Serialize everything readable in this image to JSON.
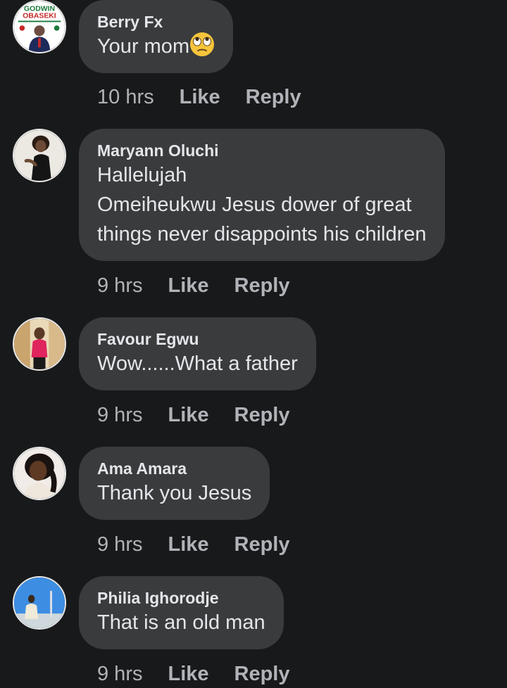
{
  "comments": [
    {
      "author": "Berry Fx",
      "lines": [
        "Your mom"
      ],
      "emoji": "eye-roll-emoji",
      "time": "10 hrs",
      "like_label": "Like",
      "reply_label": "Reply",
      "avatar": {
        "icon": "campaign-poster-avatar",
        "logo_text_1": "GODWIN",
        "logo_text_2": "OBASEKI"
      }
    },
    {
      "author": "Maryann Oluchi",
      "lines": [
        "Hallelujah",
        "Omeiheukwu Jesus dower of great",
        "things never disappoints his children"
      ],
      "time": "9 hrs",
      "like_label": "Like",
      "reply_label": "Reply",
      "avatar": {
        "icon": "woman-photo-avatar"
      }
    },
    {
      "author": "Favour Egwu",
      "lines": [
        "Wow......What a father"
      ],
      "time": "9 hrs",
      "like_label": "Like",
      "reply_label": "Reply",
      "avatar": {
        "icon": "woman-photo-avatar"
      }
    },
    {
      "author": "Ama Amara",
      "lines": [
        "Thank you Jesus"
      ],
      "time": "9 hrs",
      "like_label": "Like",
      "reply_label": "Reply",
      "avatar": {
        "icon": "woman-photo-avatar"
      }
    },
    {
      "author": "Philia Ighorodje",
      "lines": [
        "That is an old man"
      ],
      "time": "9 hrs",
      "like_label": "Like",
      "reply_label": "Reply",
      "avatar": {
        "icon": "outdoor-photo-avatar"
      }
    }
  ],
  "colors": {
    "background": "#18191a",
    "bubble": "#3a3b3c",
    "text": "#e4e6eb",
    "secondary_text": "#b0b3b8"
  }
}
